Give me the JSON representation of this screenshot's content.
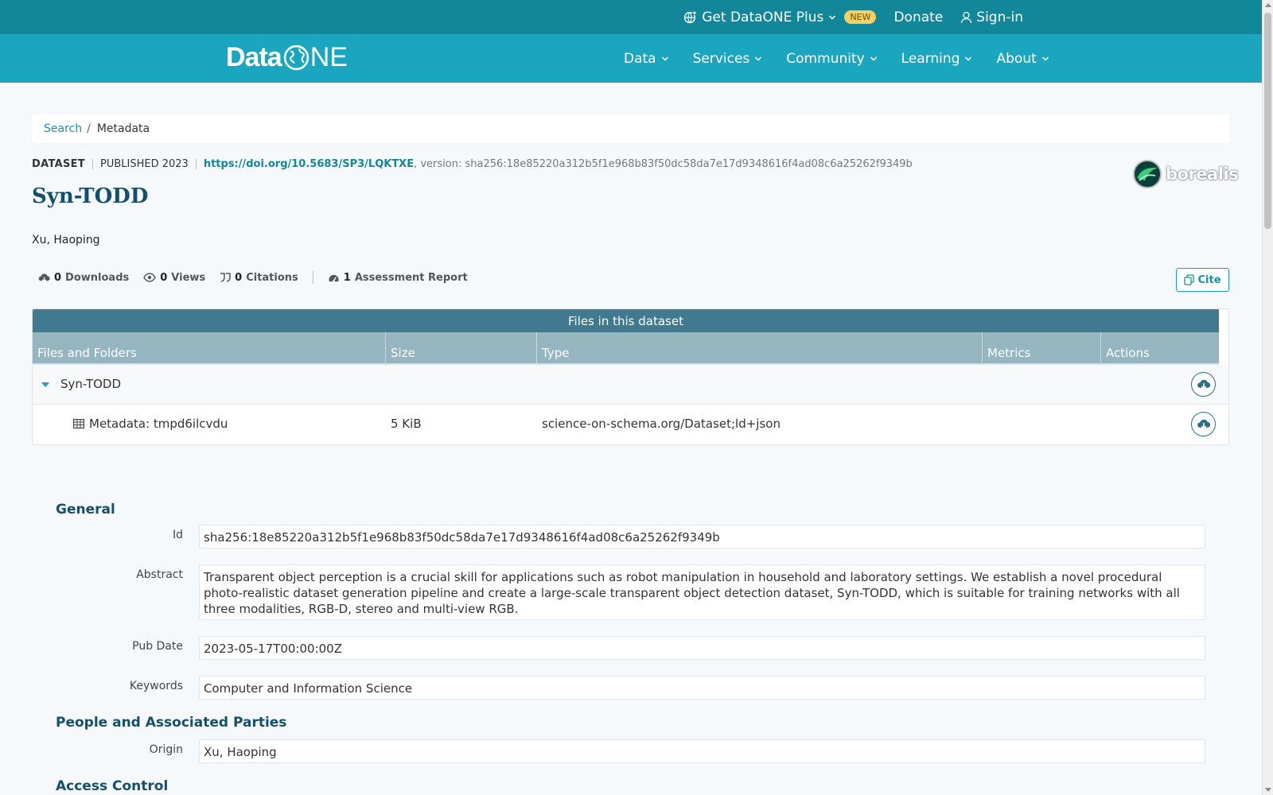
{
  "topbar": {
    "plus_label": "Get DataONE Plus",
    "new_badge": "NEW",
    "donate_label": "Donate",
    "signin_label": "Sign-in"
  },
  "nav": {
    "logo_data": "Data",
    "logo_one_o": "",
    "logo_one_rest": "NE",
    "items": [
      {
        "label": "Data"
      },
      {
        "label": "Services"
      },
      {
        "label": "Community"
      },
      {
        "label": "Learning"
      },
      {
        "label": "About"
      }
    ]
  },
  "breadcrumb": {
    "search": "Search",
    "sep": "/",
    "current": "Metadata"
  },
  "dataset": {
    "type": "DATASET",
    "published": "PUBLISHED 2023",
    "doi": "https://doi.org/10.5683/SP3/LQKTXE",
    "version": ", version: sha256:18e85220a312b5f1e968b83f50dc58da7e17d9348616f4ad08c6a25262f9349b",
    "title": "Syn-TODD",
    "author": "Xu, Haoping",
    "repository": "borealis"
  },
  "metrics": {
    "downloads_count": "0",
    "downloads_label": "Downloads",
    "views_count": "0",
    "views_label": "Views",
    "citations_count": "0",
    "citations_label": "Citations",
    "assessment_count": "1",
    "assessment_label": "Assessment Report",
    "cite_label": "Cite"
  },
  "files": {
    "title": "Files in this dataset",
    "columns": [
      "Files and Folders",
      "Size",
      "Type",
      "Metrics",
      "Actions"
    ],
    "folder": {
      "name": "Syn-TODD"
    },
    "items": [
      {
        "name": "Metadata: tmpd6ilcvdu",
        "size": "5 KiB",
        "type": "science-on-schema.org/Dataset;ld+json"
      }
    ]
  },
  "general": {
    "title": "General",
    "id_label": "Id",
    "id_value": "sha256:18e85220a312b5f1e968b83f50dc58da7e17d9348616f4ad08c6a25262f9349b",
    "abstract_label": "Abstract",
    "abstract_value": "Transparent object perception is a crucial skill for applications such as robot manipulation in household and laboratory settings. We establish a novel procedural photo-realistic dataset generation pipeline and create a large-scale transparent object detection dataset, Syn-TODD, which is suitable for training networks with all three modalities, RGB-D, stereo and multi-view RGB.",
    "pubdate_label": "Pub Date",
    "pubdate_value": "2023-05-17T00:00:00Z",
    "keywords_label": "Keywords",
    "keywords_value": "Computer and Information Science"
  },
  "people": {
    "title": "People and Associated Parties",
    "origin_label": "Origin",
    "origin_value": "Xu, Haoping"
  },
  "access": {
    "title": "Access Control"
  },
  "colors": {
    "topbar": "#13879a",
    "navbar": "#1ba6c0",
    "table_title": "#41798e",
    "table_head": "#95b5c1",
    "heading": "#144f6c",
    "link": "#13879a"
  },
  "icons": {
    "plus": "globe-plus-icon",
    "signin": "user-icon",
    "downloads": "cloud-download-icon",
    "views": "eye-icon",
    "citations": "quote-icon",
    "assessment": "gauge-icon",
    "cite": "copy-icon",
    "file": "table-icon",
    "download": "cloud-download-icon"
  }
}
